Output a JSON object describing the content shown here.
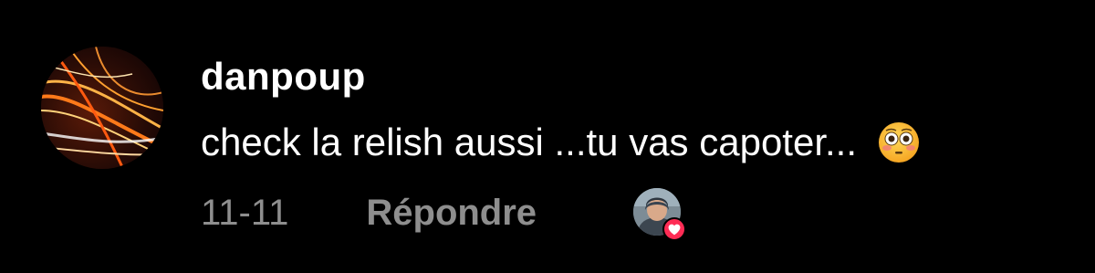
{
  "comment": {
    "username": "danpoup",
    "text": "check la relish aussi ...tu vas capoter...",
    "emoji": "flushed-face-emoji",
    "date": "11-11",
    "reply_label": "Répondre",
    "liked_by_creator": true
  },
  "colors": {
    "background": "#000000",
    "username": "#ffffff",
    "text": "#ffffff",
    "meta": "#8e8e8e",
    "heart_badge": "#fe2c55"
  }
}
